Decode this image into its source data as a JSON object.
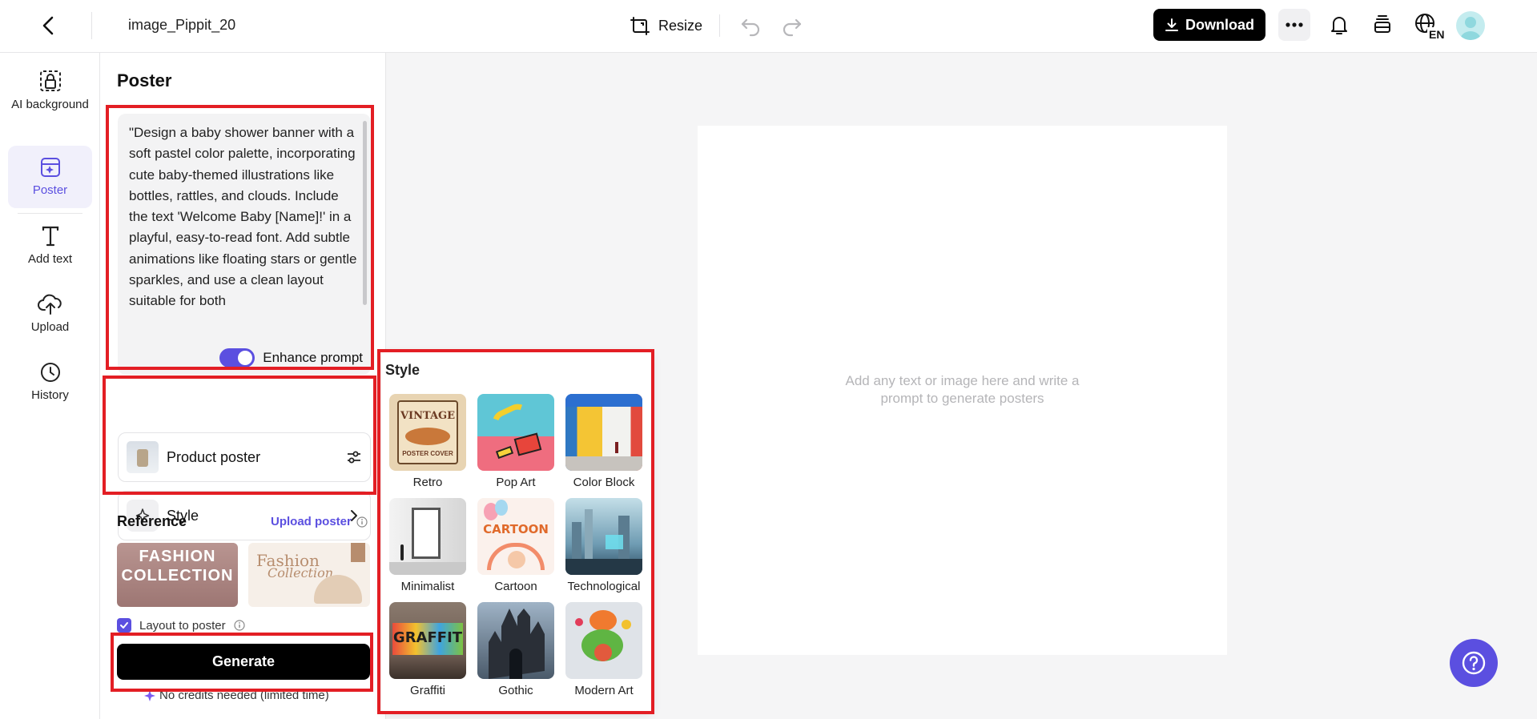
{
  "header": {
    "doc_title": "image_Pippit_20",
    "resize_label": "Resize",
    "download_label": "Download",
    "lang_badge": "EN"
  },
  "leftnav": {
    "items": [
      {
        "label": "AI background",
        "icon": "lock-dashed-icon"
      },
      {
        "label": "Poster",
        "icon": "poster-sparkle-icon",
        "active": true
      },
      {
        "label": "Add text",
        "icon": "text-icon"
      },
      {
        "label": "Upload",
        "icon": "cloud-upload-icon"
      },
      {
        "label": "History",
        "icon": "clock-icon"
      }
    ]
  },
  "panel": {
    "title": "Poster",
    "prompt_text": "\"Design a baby shower banner with a soft pastel color palette, incorporating cute baby-themed illustrations like bottles, rattles, and clouds. Include the text 'Welcome Baby [Name]!' in a playful, easy-to-read font. Add subtle animations like floating stars or gentle sparkles, and use a clean layout suitable for both",
    "enhance_label": "Enhance prompt",
    "enhance_on": true,
    "type_label": "Product poster",
    "style_label": "Style",
    "reference_label": "Reference",
    "upload_poster_label": "Upload poster",
    "ref_images": [
      {
        "line1": "FASHION",
        "line2": "COLLECTION"
      },
      {
        "line1": "Fashion",
        "line2": "Collection"
      }
    ],
    "layout_label": "Layout to poster",
    "layout_checked": true,
    "generate_label": "Generate",
    "credits_note": "No credits needed (limited time)"
  },
  "canvas": {
    "hint_line1": "Add any text or image here and write a",
    "hint_line2": "prompt to generate posters"
  },
  "style_popup": {
    "title": "Style",
    "styles": [
      {
        "label": "Retro",
        "thumb_text1": "VINTAGE",
        "thumb_text2": "POSTER COVER"
      },
      {
        "label": "Pop Art"
      },
      {
        "label": "Color Block"
      },
      {
        "label": "Minimalist"
      },
      {
        "label": "Cartoon",
        "thumb_text1": "CARTOON"
      },
      {
        "label": "Technological"
      },
      {
        "label": "Graffiti",
        "thumb_text1": "GRAFFIT"
      },
      {
        "label": "Gothic"
      },
      {
        "label": "Modern Art"
      }
    ]
  },
  "colors": {
    "accent": "#5b4fe0",
    "highlight_box": "#e31e24",
    "primary_button": "#000000"
  }
}
